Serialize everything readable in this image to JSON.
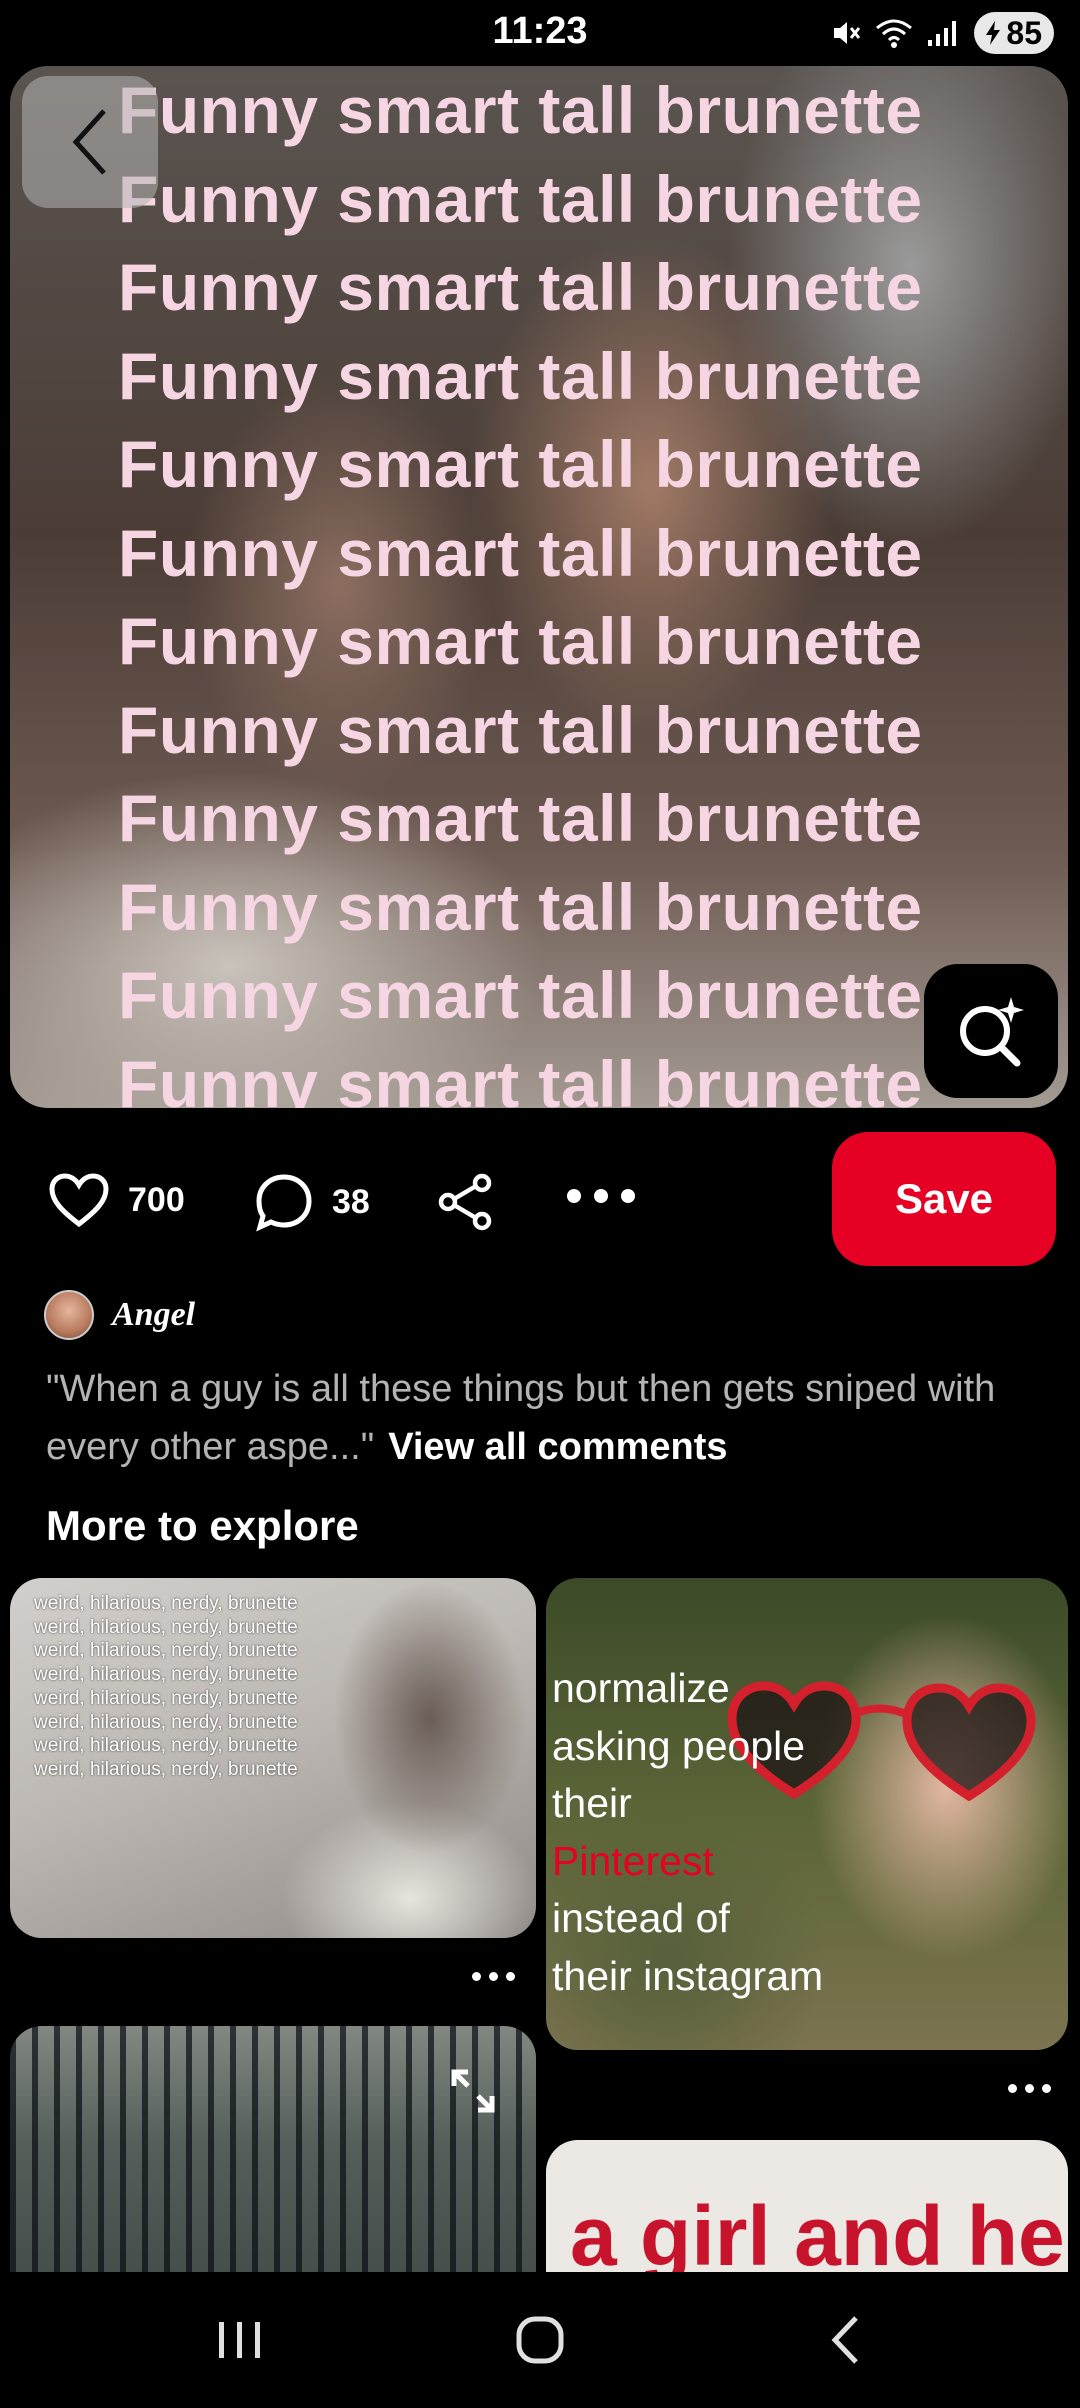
{
  "status_bar": {
    "time": "11:23",
    "battery": "85"
  },
  "pin": {
    "overlay_lines": [
      "Funny smart tall brunette",
      "Funny smart tall brunette",
      "Funny smart tall brunette",
      "Funny smart tall brunette",
      "Funny smart tall brunette",
      "Funny smart tall brunette",
      "Funny smart tall brunette",
      "Funny smart tall brunette",
      "Funny smart tall brunette",
      "Funny smart tall brunette",
      "Funny smart tall brunette",
      "Funny smart tall brunette"
    ]
  },
  "actions": {
    "likes": "700",
    "comments": "38",
    "save_label": "Save"
  },
  "comment_preview": {
    "author": "Angel",
    "text": "\"When a guy is all these things but then gets sniped with every other aspe...\"",
    "view_all": "View all comments"
  },
  "explore": {
    "title": "More to explore",
    "card1_lines": [
      "weird, hilarious, nerdy, brunette",
      "weird, hilarious, nerdy, brunette",
      "weird, hilarious, nerdy, brunette",
      "weird, hilarious, nerdy, brunette",
      "weird, hilarious, nerdy, brunette",
      "weird, hilarious, nerdy, brunette",
      "weird, hilarious, nerdy, brunette",
      "weird, hilarious, nerdy, brunette"
    ],
    "card2_lines": [
      "normalize",
      "asking people",
      "their",
      "Pinterest",
      "instead of",
      "their instagram"
    ],
    "card4_text": "a girl and her"
  },
  "colors": {
    "save": "#e60023",
    "overlay_text": "#f6d6e3",
    "accent_text": "#e60023"
  }
}
